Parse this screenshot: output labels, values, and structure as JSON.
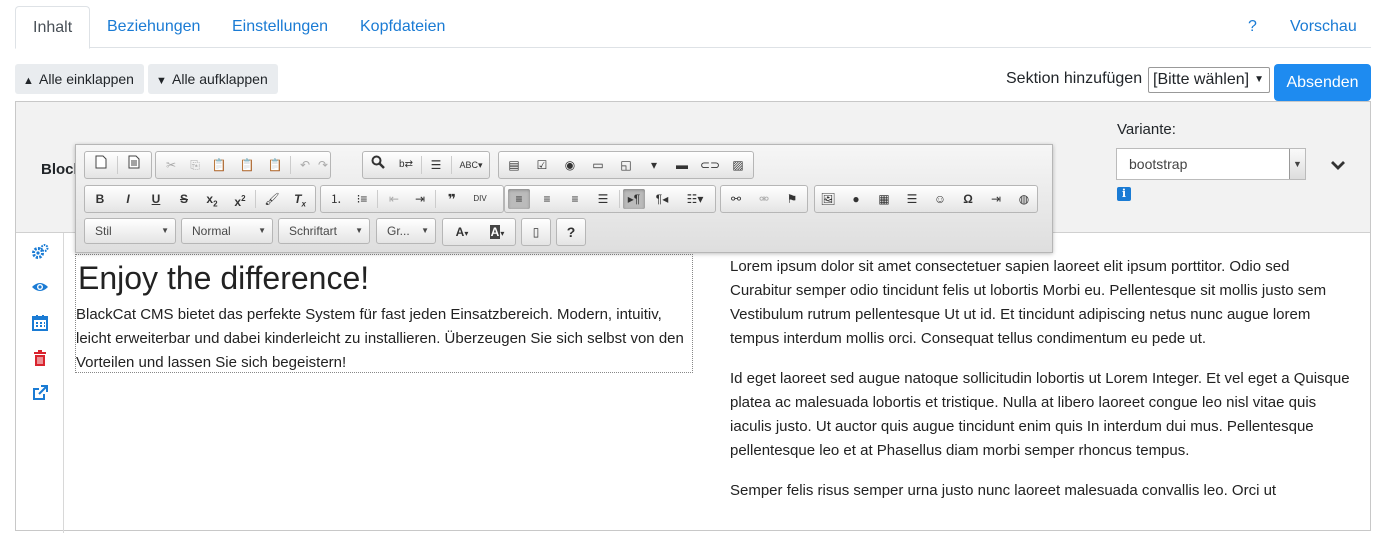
{
  "tabs": {
    "content": "Inhalt",
    "relations": "Beziehungen",
    "settings": "Einstellungen",
    "headers": "Kopfdateien",
    "help": "?",
    "preview": "Vorschau"
  },
  "toolbar": {
    "collapse_all": "Alle einklappen",
    "expand_all": "Alle aufklappen",
    "add_section_label": "Sektion hinzufügen",
    "add_section_value": "[Bitte wählen]",
    "submit": "Absenden"
  },
  "block": {
    "label": "Block",
    "variant_label": "Variante:",
    "variant_value": "bootstrap",
    "info": "i"
  },
  "editor": {
    "combos": {
      "style": "Stil",
      "format": "Normal",
      "font": "Schriftart",
      "size": "Gr...",
      "help": "?"
    }
  },
  "content": {
    "heading": "Enjoy the difference!",
    "intro": "BlackCat CMS bietet das perfekte System für fast jeden Einsatzbereich. Modern, intuitiv, leicht erweiterbar und dabei kinderleicht zu installieren. Überzeugen Sie sich selbst von den Vorteilen und lassen Sie sich begeistern!",
    "paragraphs": [
      "Lorem ipsum dolor sit amet consectetuer sapien laoreet elit ipsum porttitor. Odio sed Curabitur semper odio tincidunt felis ut lobortis Morbi eu. Pellentesque sit mollis justo sem Vestibulum rutrum pellentesque Ut ut id. Et tincidunt adipiscing netus nunc augue lorem tempus interdum mollis orci. Consequat tellus condimentum eu pede ut.",
      "Id eget laoreet sed augue natoque sollicitudin lobortis ut Lorem Integer. Et vel eget a Quisque platea ac malesuada lobortis et tristique. Nulla at libero laoreet congue leo nisl vitae quis iaculis justo. Ut auctor quis augue tincidunt enim quis In interdum dui mus. Pellentesque pellentesque leo et at Phasellus diam morbi semper rhoncus tempus.",
      "Semper felis risus semper urna justo nunc laoreet malesuada convallis leo. Orci ut"
    ]
  },
  "colors": {
    "link": "#1a7bd4",
    "primary": "#1e8bf0",
    "danger": "#d9232e"
  }
}
